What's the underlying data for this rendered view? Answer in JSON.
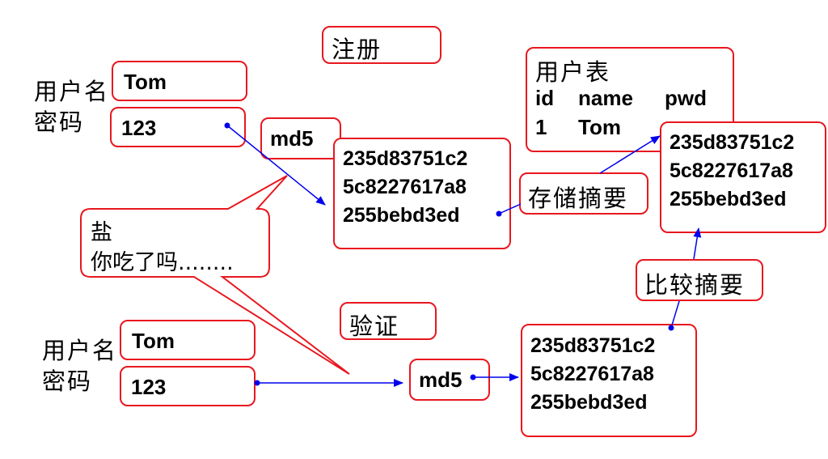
{
  "register": {
    "title": "注册",
    "username_label": "用户名",
    "password_label": "密码",
    "username": "Tom",
    "password": "123",
    "md5": "md5",
    "hash": [
      "235d83751c2",
      "5c8227617a8",
      "255bebd3ed"
    ]
  },
  "salt": {
    "line1": "盐",
    "line2": "你吃了吗........"
  },
  "store_label": "存储摘要",
  "user_table": {
    "title": "用户表",
    "columns": [
      "id",
      "name",
      "pwd"
    ],
    "row": [
      "1",
      "Tom"
    ],
    "hash": [
      "235d83751c2",
      "5c8227617a8",
      "255bebd3ed"
    ]
  },
  "verify": {
    "title": "验证",
    "username_label": "用户名",
    "password_label": "密码",
    "username": "Tom",
    "password": "123",
    "md5": "md5",
    "hash": [
      "235d83751c2",
      "5c8227617a8",
      "255bebd3ed"
    ]
  },
  "compare_label": "比较摘要",
  "colors": {
    "border": "#e8171f",
    "arrow": "#0000ee"
  }
}
